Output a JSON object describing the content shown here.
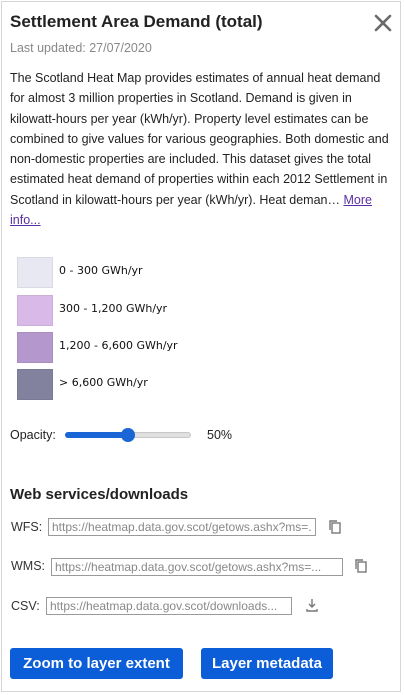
{
  "panel": {
    "title": "Settlement Area Demand (total)",
    "last_updated": "Last updated: 27/07/2020",
    "description": "The Scotland Heat Map provides estimates of annual heat demand for almost 3 million properties in Scotland. Demand is given in kilowatt-hours per year (kWh/yr). Property level estimates can be combined to give values for various geographies. Both domestic and non-domestic properties are included. This dataset gives the total estimated heat demand of properties within each 2012 Settlement in Scotland in kilowatt-hours per year (kWh/yr). Heat deman…",
    "more_info": "More info..."
  },
  "legend": [
    {
      "label": "0 - 300 GWh/yr",
      "color": "#e8e8f3"
    },
    {
      "label": "300 - 1,200 GWh/yr",
      "color": "#d8b9e8"
    },
    {
      "label": "1,200 - 6,600 GWh/yr",
      "color": "#b497cd"
    },
    {
      "label": "> 6,600 GWh/yr",
      "color": "#82829f"
    }
  ],
  "opacity": {
    "label": "Opacity:",
    "value_text": "50%",
    "value": 50
  },
  "services": {
    "heading": "Web services/downloads",
    "wfs": {
      "label": "WFS:",
      "value": "https://heatmap.data.gov.scot/getows.ashx?ms=..."
    },
    "wms": {
      "label": "WMS:",
      "value": "https://heatmap.data.gov.scot/getows.ashx?ms=..."
    },
    "csv": {
      "label": "CSV:",
      "value": "https://heatmap.data.gov.scot/downloads..."
    }
  },
  "buttons": {
    "zoom": "Zoom to layer extent",
    "metadata": "Layer metadata"
  },
  "colors": {
    "accent": "#0b5ed7",
    "link": "#5a2ea0"
  }
}
